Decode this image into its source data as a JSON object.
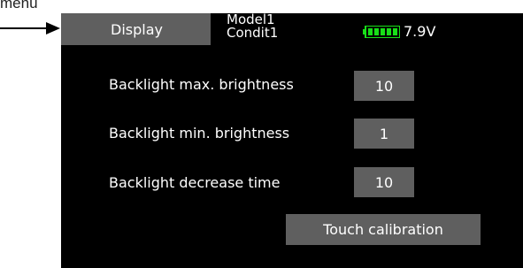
{
  "annotation": {
    "label": "menu"
  },
  "header": {
    "menu_tab": "Display",
    "model_name": "Model1",
    "condition_name": "Condit1",
    "battery_voltage": "7.9V",
    "battery_level": 1.0
  },
  "settings": [
    {
      "label": "Backlight max. brightness",
      "value": "10"
    },
    {
      "label": "Backlight min. brightness",
      "value": "1"
    },
    {
      "label": "Backlight decrease time",
      "value": "10"
    }
  ],
  "actions": {
    "touch_calibration": "Touch calibration"
  },
  "colors": {
    "screen_background": "#000000",
    "button_background": "#5f5f5f",
    "battery_green": "#18e018",
    "text": "#ffffff"
  },
  "icons": {
    "battery": "battery-icon",
    "arrow": "arrow-right-icon"
  }
}
